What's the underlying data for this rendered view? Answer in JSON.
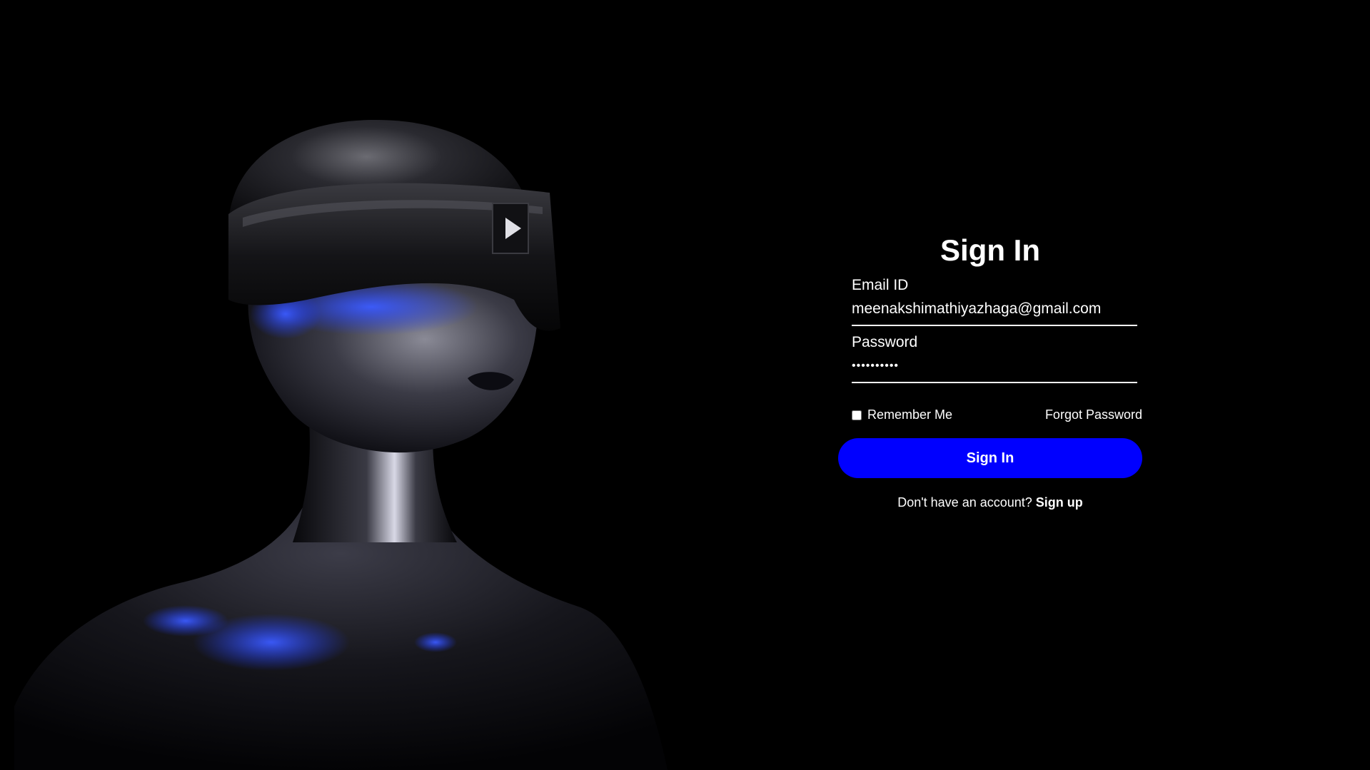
{
  "hero": {
    "image": "chrome-robot-woman-with-visor",
    "accent_glow": "#1f3bff"
  },
  "form": {
    "title": "Sign In",
    "email": {
      "label": "Email ID",
      "value": "meenakshimathiyazhaga@gmail.com"
    },
    "password": {
      "label": "Password",
      "value": "••••••••••"
    },
    "remember": {
      "label": "Remember Me",
      "checked": false
    },
    "forgot_label": "Forgot Password",
    "submit_label": "Sign In",
    "submit_color": "#0000ff",
    "signup_prompt": "Don't have an account?",
    "signup_link": "Sign up"
  }
}
